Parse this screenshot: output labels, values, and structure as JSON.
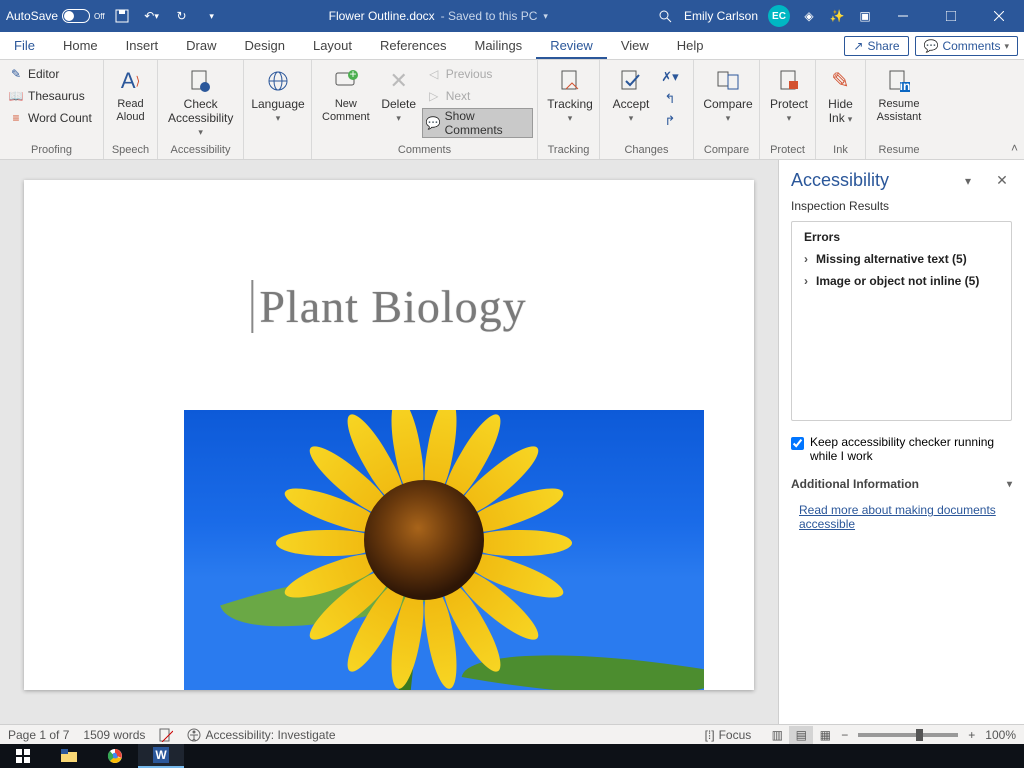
{
  "titlebar": {
    "autosave": "AutoSave",
    "autosave_state": "Off",
    "doc": "Flower Outline.docx",
    "saved": " - Saved to this PC",
    "user": "Emily Carlson",
    "initials": "EC"
  },
  "tabs": [
    "File",
    "Home",
    "Insert",
    "Draw",
    "Design",
    "Layout",
    "References",
    "Mailings",
    "Review",
    "View",
    "Help"
  ],
  "active_tab": "Review",
  "menu_buttons": {
    "share": "Share",
    "comments": "Comments"
  },
  "ribbon": {
    "proofing": {
      "label": "Proofing",
      "editor": "Editor",
      "thesaurus": "Thesaurus",
      "wordcount": "Word Count"
    },
    "speech": {
      "label": "Speech",
      "readaloud": "Read\nAloud"
    },
    "accessibility": {
      "label": "Accessibility",
      "check": "Check\nAccessibility"
    },
    "language": {
      "label": "Language",
      "lang": "Language"
    },
    "comments": {
      "label": "Comments",
      "new": "New\nComment",
      "delete": "Delete",
      "previous": "Previous",
      "next": "Next",
      "show": "Show Comments"
    },
    "tracking": {
      "label": "Tracking",
      "btn": "Tracking"
    },
    "changes": {
      "label": "Changes",
      "accept": "Accept"
    },
    "compare": {
      "label": "Compare",
      "btn": "Compare"
    },
    "protect": {
      "label": "Protect",
      "btn": "Protect"
    },
    "ink": {
      "label": "Ink",
      "btn": "Hide\nInk"
    },
    "resume": {
      "label": "Resume",
      "btn": "Resume\nAssistant"
    }
  },
  "document": {
    "title": "Plant Biology"
  },
  "pane": {
    "title": "Accessibility",
    "sub": "Inspection Results",
    "cat": "Errors",
    "items": [
      "Missing alternative text (5)",
      "Image or object not inline (5)"
    ],
    "keep": "Keep accessibility checker running while I work",
    "more": "Additional Information",
    "link": "Read more about making documents accessible"
  },
  "status": {
    "page": "Page 1 of 7",
    "words": "1509 words",
    "acc": "Accessibility: Investigate",
    "focus": "Focus",
    "zoom": "100%"
  }
}
